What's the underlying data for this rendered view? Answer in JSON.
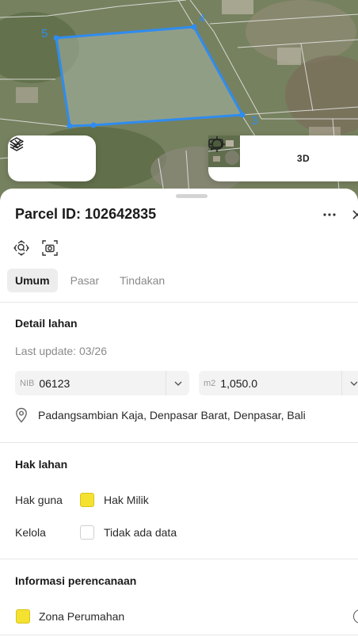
{
  "map": {
    "vertex_labels": [
      "5",
      "4",
      "3"
    ],
    "parcel_color": "#2f8cf0",
    "buttons": {
      "layers": "layers-icon",
      "measure": "measure-icon",
      "locate": "crosshair-icon",
      "three_d_label": "3D",
      "chat": "chat-icon"
    }
  },
  "parcel": {
    "title": "Parcel ID: 102642835",
    "tabs": [
      {
        "label": "Umum",
        "active": true
      },
      {
        "label": "Pasar",
        "active": false
      },
      {
        "label": "Tindakan",
        "active": false
      }
    ]
  },
  "detail": {
    "heading": "Detail lahan",
    "last_update": "Last update: 03/26",
    "nib_prefix": "NIB",
    "nib_value": "06123",
    "area_prefix": "m2",
    "area_value": "1,050.0",
    "address": "Padangsambian Kaja, Denpasar Barat, Denpasar, Bali"
  },
  "rights": {
    "heading": "Hak lahan",
    "rows": [
      {
        "label": "Hak guna",
        "value": "Hak Milik",
        "color": "#f5e130"
      },
      {
        "label": "Kelola",
        "value": "Tidak ada data",
        "color": ""
      }
    ]
  },
  "planning": {
    "heading": "Informasi perencanaan",
    "zone": "Zona Perumahan",
    "zone_color": "#f5e130"
  }
}
